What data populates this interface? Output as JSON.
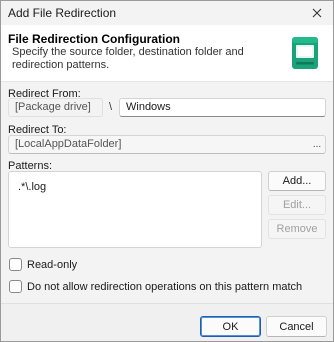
{
  "window": {
    "title": "Add File Redirection"
  },
  "header": {
    "title": "File Redirection Configuration",
    "description": "Specify the source folder, destination folder and redirection patterns.",
    "icon": "drive-icon",
    "accent_color": "#1aa37a"
  },
  "redirect_from": {
    "label": "Redirect From:",
    "drive_value": "[Package drive]",
    "separator": "\\",
    "folder_value": "Windows"
  },
  "redirect_to": {
    "label": "Redirect To:",
    "value": "[LocalAppDataFolder]",
    "browse_label": "..."
  },
  "patterns": {
    "label": "Patterns:",
    "items": [
      ".*\\.log"
    ],
    "add_label": "Add...",
    "edit_label": "Edit...",
    "remove_label": "Remove"
  },
  "options": {
    "readonly_label": "Read-only",
    "readonly_checked": false,
    "no_redirect_label": "Do not allow redirection operations on this pattern match",
    "no_redirect_checked": false
  },
  "footer": {
    "ok_label": "OK",
    "cancel_label": "Cancel"
  }
}
